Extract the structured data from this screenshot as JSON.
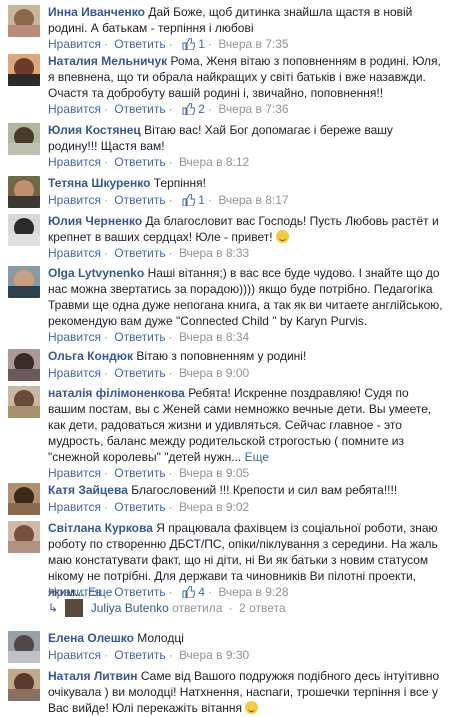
{
  "ui": {
    "like": "Нравится",
    "reply": "Ответить",
    "more": "Еще"
  },
  "comments": [
    {
      "name": "Инна Иванченко",
      "text": "Дай Боже, щоб дитинка знайшла щастя в новій родині. А батькам - терпіння і любові",
      "likes": "1",
      "time": "Вчера в 7:35"
    },
    {
      "name": "Наталия Мельничук",
      "text": "Рома, Женя вітаю з поповненням в родині. Юля, я впевнена, що ти обрала найкращих у світі батьків і вже назавжди. Очастя та добробуту вашій родині і, звичайно, поповнення!!",
      "likes": "2",
      "time": "Вчера в 7:36"
    },
    {
      "name": "Юлия Костянец",
      "text": "Вітаю вас! Хай Бог допомагає і береже вашу родину!!! Щастя вам!",
      "time": "Вчера в 8:12"
    },
    {
      "name": "Тетяна Шкуренко",
      "text": "Терпіння!",
      "likes": "1",
      "time": "Вчера в 8:17"
    },
    {
      "name": "Юлия Черненко",
      "text": "Да благословит вас Господь! Пусть Любовь растёт и крепнет в ваших сердцах! Юле - привет!",
      "time": "Вчера в 8:33"
    },
    {
      "name": "Olga Lytvynenko",
      "text": "Наші вітання;) в вас все буде чудово. І знайте що до нас можна звертатись за порадою)))) якщо буде потрібно. Педагогіка Травми ще одна дуже непогана книга, а так як ви читаете англійською, рекомендую вам дуже \"Connected Child \" by Karyn Purvis.",
      "time": "Вчера в 8:34"
    },
    {
      "name": "Ольга Кондюк",
      "text": "Вітаю з поповненням у родині!",
      "time": "Вчера в 9:00"
    },
    {
      "name": "наталія філімоненкова",
      "text": "Ребята! Искренне поздравляю! Судя по вашим постам, вы с Женей сами немножко вечные дети. Вы умеете, как дети, радоваться жизни и удивляться. Сейчас главное - это мудрость, баланс между родительской строгостью ( помните из \"снежной королевы\" \"детей нужн...",
      "time": "Вчера в 9:05"
    },
    {
      "name": "Катя Зайцева",
      "text": "Благословений !!! Крепости и сил вам ребята!!!!",
      "time": "Вчера в 9:02"
    },
    {
      "name": "Світлана Куркова",
      "text": "Я працювала фахівцем із соціальної роботи, знаю роботу по створенню ДБСТ/ПС, опіки/піклування з середини. На жаль маю констатувати факт, що ні діти, ні Ви як батьки з новим статусом нікому не потрібні. Для держави та чиновників Ви пілотні проекти, яким...",
      "likes": "4",
      "time": "Вчера в 9:28"
    },
    {
      "name": "Елена Олешко",
      "text": "Молодці",
      "time": "Вчера в 9:30"
    },
    {
      "name": "Наталя Литвин",
      "text": "Саме від Вашого подружжя подібного десь інтуітивно очікувала ) ви молодці! Натхнення, насnaги, трошечки терпіння і все у Вас вийде! Юлі перекажіть вітання"
    }
  ],
  "reply_thread": {
    "name": "Juliya Butenko",
    "text": "ответила",
    "count": "2 ответа"
  },
  "colors": {
    "link": "#365899",
    "action": "#4267b2",
    "meta": "#90949c",
    "text": "#1d2129"
  }
}
